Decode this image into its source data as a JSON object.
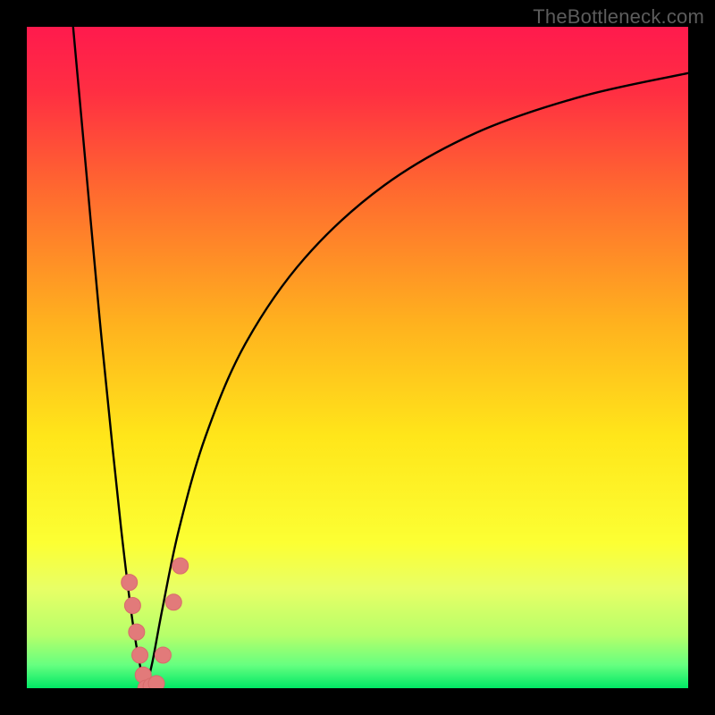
{
  "watermark": "TheBottleneck.com",
  "colors": {
    "frame": "#000000",
    "curve_stroke": "#000000",
    "marker_fill": "#e27a7a",
    "marker_stroke": "#d86b6b"
  },
  "chart_data": {
    "type": "line",
    "title": "",
    "xlabel": "",
    "ylabel": "",
    "xlim": [
      0,
      100
    ],
    "ylim": [
      0,
      100
    ],
    "gradient_stops": [
      {
        "offset": 0.0,
        "color": "#ff1a4d"
      },
      {
        "offset": 0.1,
        "color": "#ff2f42"
      },
      {
        "offset": 0.25,
        "color": "#ff6a2f"
      },
      {
        "offset": 0.45,
        "color": "#ffb21e"
      },
      {
        "offset": 0.62,
        "color": "#ffe61a"
      },
      {
        "offset": 0.78,
        "color": "#fcff33"
      },
      {
        "offset": 0.85,
        "color": "#e8ff66"
      },
      {
        "offset": 0.92,
        "color": "#b6ff6a"
      },
      {
        "offset": 0.965,
        "color": "#66ff80"
      },
      {
        "offset": 1.0,
        "color": "#00e865"
      }
    ],
    "series": [
      {
        "name": "left-branch",
        "x": [
          7.0,
          9.0,
          11.0,
          13.0,
          14.5,
          16.0,
          17.2,
          18.0
        ],
        "y": [
          100.0,
          78.0,
          56.0,
          36.0,
          22.0,
          10.0,
          3.0,
          0.0
        ]
      },
      {
        "name": "right-branch",
        "x": [
          18.0,
          19.0,
          20.5,
          23.0,
          27.0,
          33.0,
          42.0,
          54.0,
          68.0,
          84.0,
          100.0
        ],
        "y": [
          0.0,
          4.0,
          12.0,
          24.0,
          38.0,
          52.0,
          65.0,
          76.0,
          84.0,
          89.5,
          93.0
        ]
      }
    ],
    "markers": [
      {
        "x": 15.5,
        "y": 16.0
      },
      {
        "x": 16.0,
        "y": 12.5
      },
      {
        "x": 16.6,
        "y": 8.5
      },
      {
        "x": 17.1,
        "y": 5.0
      },
      {
        "x": 17.6,
        "y": 2.0
      },
      {
        "x": 18.0,
        "y": 0.0
      },
      {
        "x": 18.8,
        "y": 0.3
      },
      {
        "x": 19.6,
        "y": 0.7
      },
      {
        "x": 20.6,
        "y": 5.0
      },
      {
        "x": 22.2,
        "y": 13.0
      },
      {
        "x": 23.2,
        "y": 18.5
      }
    ],
    "marker_radius_px": 9
  }
}
